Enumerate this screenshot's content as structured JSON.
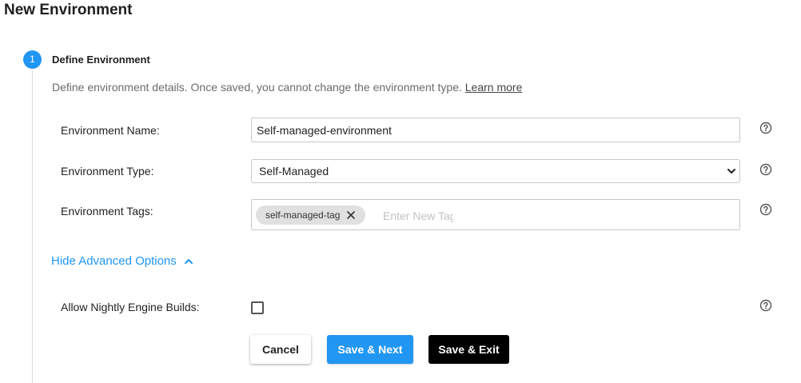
{
  "page": {
    "title": "New Environment"
  },
  "step": {
    "number": "1",
    "title": "Define Environment",
    "description": "Define environment details. Once saved, you cannot change the environment type.",
    "learn_more": "Learn more"
  },
  "form": {
    "name_label": "Environment Name:",
    "name_value": "Self-managed-environment",
    "type_label": "Environment Type:",
    "type_value": "Self-Managed",
    "tags_label": "Environment Tags:",
    "tags": [
      "self-managed-tag"
    ],
    "tag_placeholder": "Enter New Tag",
    "nightly_label": "Allow Nightly Engine Builds:",
    "nightly_checked": false
  },
  "advanced": {
    "toggle_label": "Hide Advanced Options"
  },
  "buttons": {
    "cancel": "Cancel",
    "save_next": "Save & Next",
    "save_exit": "Save & Exit"
  },
  "colors": {
    "accent": "#2196f3",
    "primary_dark": "#000000"
  },
  "icons": [
    "help-icon",
    "close-icon",
    "chevron-up-icon",
    "chevron-down-icon"
  ]
}
